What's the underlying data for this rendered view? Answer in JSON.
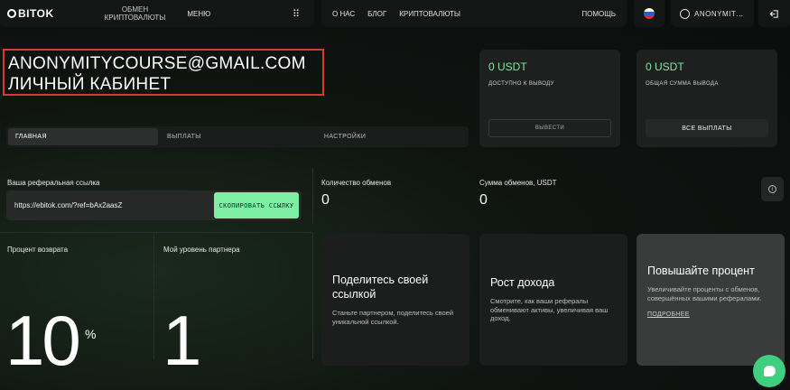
{
  "nav": {
    "logo": "BITOK",
    "exchange_line1": "ОБМЕН",
    "exchange_line2": "КРИПТОВАЛЮТЫ",
    "menu": "МЕНЮ",
    "links": [
      "О НАС",
      "БЛОГ",
      "КРИПТОВАЛЮТЫ"
    ],
    "help": "ПОМОЩЬ",
    "user": "ANONYMIT…"
  },
  "header": {
    "email": "ANONYMITYCOURSE@GMAIL.COM",
    "title": "ЛИЧНЫЙ КАБИНЕТ"
  },
  "balances": [
    {
      "amount": "0 USDT",
      "caption": "ДОСТУПНО К ВЫВОДУ",
      "button": "ВЫВЕСТИ"
    },
    {
      "amount": "0 USDT",
      "caption": "ОБЩАЯ СУММА ВЫВОДА",
      "button": "ВСЕ ВЫПЛАТЫ"
    }
  ],
  "tabs": [
    "ГЛАВНАЯ",
    "ВЫПЛАТЫ",
    "НАСТРОЙКИ"
  ],
  "referral": {
    "label": "Ваша реферальная ссылка",
    "url": "https://ebitok.com/?ref=bAx2aasZ",
    "copy": "СКОПИРОВАТЬ ССЫЛКУ"
  },
  "stats": {
    "exchanges_label": "Количество обменов",
    "exchanges_value": "0",
    "sum_label": "Сумма обменов, USDT",
    "sum_value": "0"
  },
  "metrics": {
    "return_label": "Процент возврата",
    "return_value": "10",
    "return_unit": "%",
    "level_label": "Мой уровень партнера",
    "level_value": "1"
  },
  "features": [
    {
      "title": "Поделитесь своей ссылкой",
      "desc": "Станьте партнером, поделитесь своей уникальной ссылкой."
    },
    {
      "title": "Рост дохода",
      "desc": "Смотрите, как ваши рефералы обменивают активы, увеличивая ваш доход."
    },
    {
      "title": "Повышайте процент",
      "desc": "Увеличивайте проценты с обменов, совершённых вашими рефералами.",
      "link": "ПОДРОБНЕЕ"
    }
  ],
  "colors": {
    "accent_green": "#7ef0a5",
    "highlight_border": "#d83a2e",
    "chat_green": "#3ed07f"
  }
}
